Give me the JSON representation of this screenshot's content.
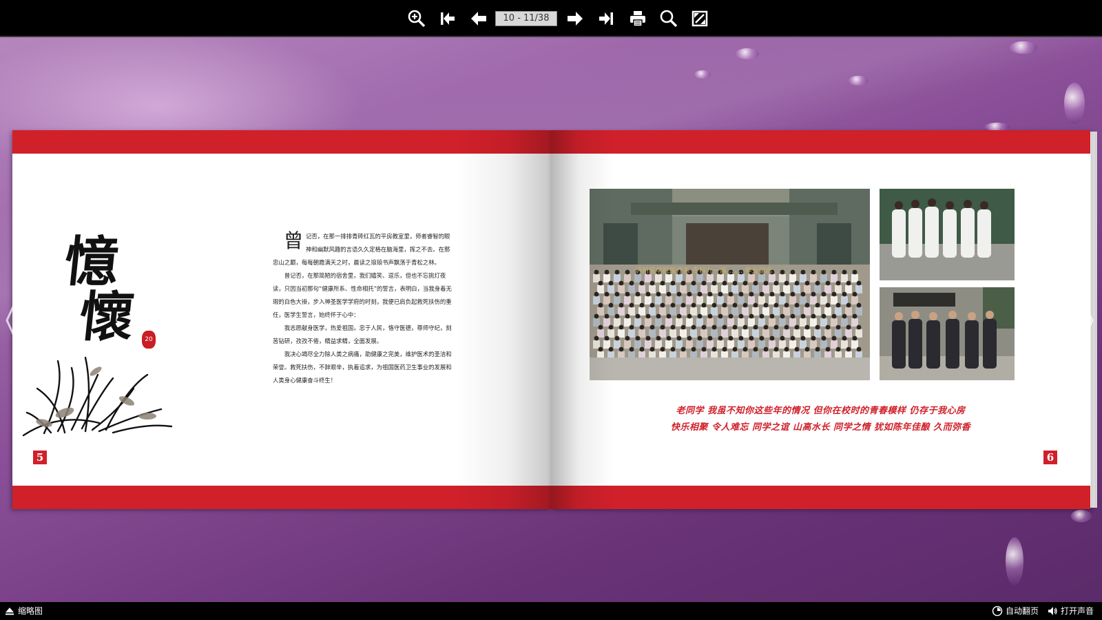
{
  "toolbar": {
    "page_indicator": "10 - 11/38",
    "icons": [
      "zoom-in-icon",
      "first-page-icon",
      "previous-page-icon",
      "next-page-icon",
      "last-page-icon",
      "print-icon",
      "search-icon",
      "fullscreen-icon"
    ]
  },
  "left_page": {
    "calligraphy_line1": "憶",
    "calligraphy_line2": "懷",
    "seal_text": "20",
    "drop_cap": "曾",
    "paragraph_1": "记否，在那一排排青砖红瓦的平房教室里，师者睿智的眼神和幽默风趣的言语久久定格在脑海里，挥之不去。在那忠山之巅，每每朝霞满天之时，晨读之琅琅书声飘荡于青松之林。",
    "paragraph_2": "曾记否，在那简陋的宿舍里，我们嬉笑、逗乐，但也不忘挑灯夜读，只因当初那句“健康所系、性命相托”的誓言，表明白，当我身着无瑕的白色大褂，步入神圣医学学府的时刻，我便已肩负起救死扶伤的重任，医学生誓言，始终怀于心中：",
    "paragraph_3": "我志愿献身医学，热爱祖国，忠于人民，恪守医德，尊师守纪，刻苦钻研，孜孜不倦，精益求精，全面发展。",
    "paragraph_4": "我决心竭尽全力除人类之病痛，助健康之完美，维护医术的圣洁和荣誉。救死扶伤，不辞艰辛，执着追求，为祖国医药卫生事业的发展和人类身心健康奋斗终生！",
    "page_number": "5"
  },
  "right_page": {
    "photo_banner": "泸州医学院医疗系 专科九一届 …… 毕业留念",
    "poem_line1": "老同学  我虽不知你这些年的情况  但你在校时的青春模样  仍存于我心房",
    "poem_line2": "快乐相聚  令人难忘  同学之谊  山高水长  同学之情  犹如陈年佳酿  久而弥香",
    "page_number": "6"
  },
  "bottombar": {
    "thumbnails_label": "缩略图",
    "auto_flip_label": "自动翻页",
    "sound_label": "打开声音"
  },
  "colors": {
    "accent_red": "#d0202a",
    "toolbar_bg": "#000000",
    "background_purple": "#8a4f98"
  }
}
